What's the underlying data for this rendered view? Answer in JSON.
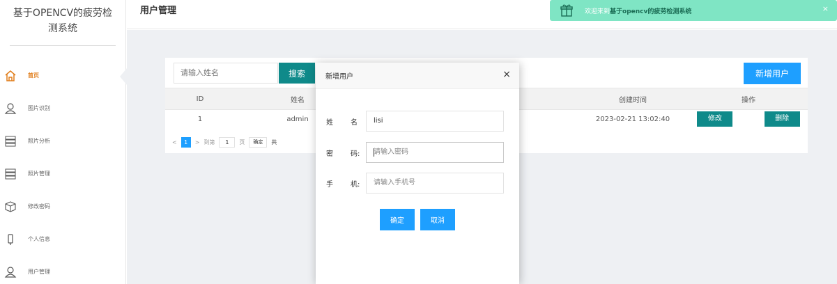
{
  "sidebar": {
    "brand": "基于OPENCV的疲劳检测系统",
    "items": [
      {
        "label": "首页",
        "icon": "home-icon"
      },
      {
        "label": "图片识别",
        "icon": "user-icon"
      },
      {
        "label": "照片分析",
        "icon": "server-icon"
      },
      {
        "label": "照片管理",
        "icon": "server-icon"
      },
      {
        "label": "修改密码",
        "icon": "box-icon"
      },
      {
        "label": "个人信息",
        "icon": "phone-icon"
      },
      {
        "label": "用户管理",
        "icon": "user-icon"
      }
    ]
  },
  "header": {
    "title": "用户管理",
    "notice_prefix": "欢迎来到",
    "notice_bold": "基于opencv的疲劳检测系统",
    "notice_close": "×"
  },
  "toolbar": {
    "search_placeholder": "请输入姓名",
    "search_label": "搜索",
    "add_label": "新增用户"
  },
  "table": {
    "headers": [
      "ID",
      "姓名",
      "创建时间",
      "操作"
    ],
    "rows": [
      {
        "id": "1",
        "name": "admin",
        "created": "2023-02-21 13:02:40",
        "edit": "修改",
        "delete": "删除"
      }
    ]
  },
  "pager": {
    "prev": "<",
    "current": "1",
    "next": ">",
    "goto": "到第",
    "page_value": "1",
    "page_unit": "页",
    "confirm": "确定",
    "total": "共"
  },
  "modal": {
    "title": "新增用户",
    "close": "×",
    "fields": [
      {
        "label1": "姓",
        "label2": "名",
        "value": "lisi",
        "placeholder": ""
      },
      {
        "label1": "密",
        "label2": "码:",
        "value": "",
        "placeholder": "请输入密码"
      },
      {
        "label1": "手",
        "label2": "机:",
        "value": "",
        "placeholder": "请输入手机号"
      }
    ],
    "confirm_label": "确定",
    "cancel_label": "取消"
  },
  "colors": {
    "accent_teal": "#0f8a8a",
    "accent_blue": "#1e9fff",
    "notice_bg": "#7fe5c4",
    "active_menu": "#e07d1a"
  }
}
